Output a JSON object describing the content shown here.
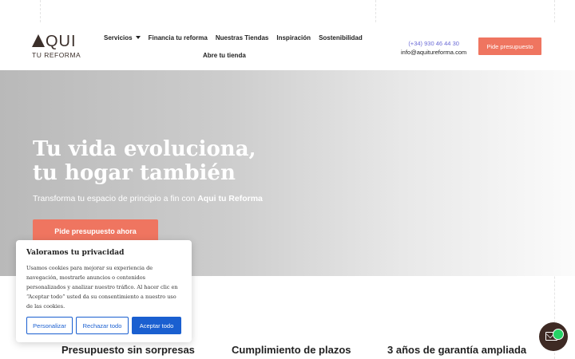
{
  "header": {
    "logo_main": "QUI",
    "logo_sub": "TU REFORMA",
    "nav": [
      {
        "label": "Servicios"
      },
      {
        "label": "Financia tu reforma"
      },
      {
        "label": "Nuestras Tiendas"
      },
      {
        "label": "Inspiración"
      },
      {
        "label": "Sostenibilidad"
      },
      {
        "label": "Abre tu tienda"
      }
    ],
    "phone": "(+34) 930 46 44 30",
    "email": "info@aquitureforma.com",
    "cta": "Pide presupuesto"
  },
  "hero": {
    "title_line1": "Tu vida evoluciona,",
    "title_line2": "tu hogar también",
    "subtitle_prefix": "Transforma tu espacio de principio a fin con ",
    "subtitle_brand": "Aqui tu Reforma",
    "cta": "Pide presupuesto ahora"
  },
  "features": [
    {
      "title": "Presupuesto sin sorpresas"
    },
    {
      "title": "Cumplimiento de plazos"
    },
    {
      "title": "3 años de garantía ampliada"
    }
  ],
  "cookie": {
    "title": "Valoramos tu privacidad",
    "text": "Usamos cookies para mejorar su experiencia de navegación, mostrarle anuncios o contenidos personalizados y analizar nuestro tráfico. Al hacer clic en “Aceptar todo” usted da su consentimiento a nuestro uso de las cookies.",
    "btn_customize": "Personalizar",
    "btn_reject": "Rechazar todo",
    "btn_accept": "Aceptar todo"
  },
  "colors": {
    "accent": "#ef7560",
    "brand_dark": "#3b2f2a",
    "cookie_blue": "#1a5fd0",
    "whatsapp": "#25d366"
  },
  "icons": {
    "nav_dropdown": "chevron-down-icon",
    "float_widget": "contact-envelope-icon",
    "float_badge": "whatsapp-icon"
  }
}
